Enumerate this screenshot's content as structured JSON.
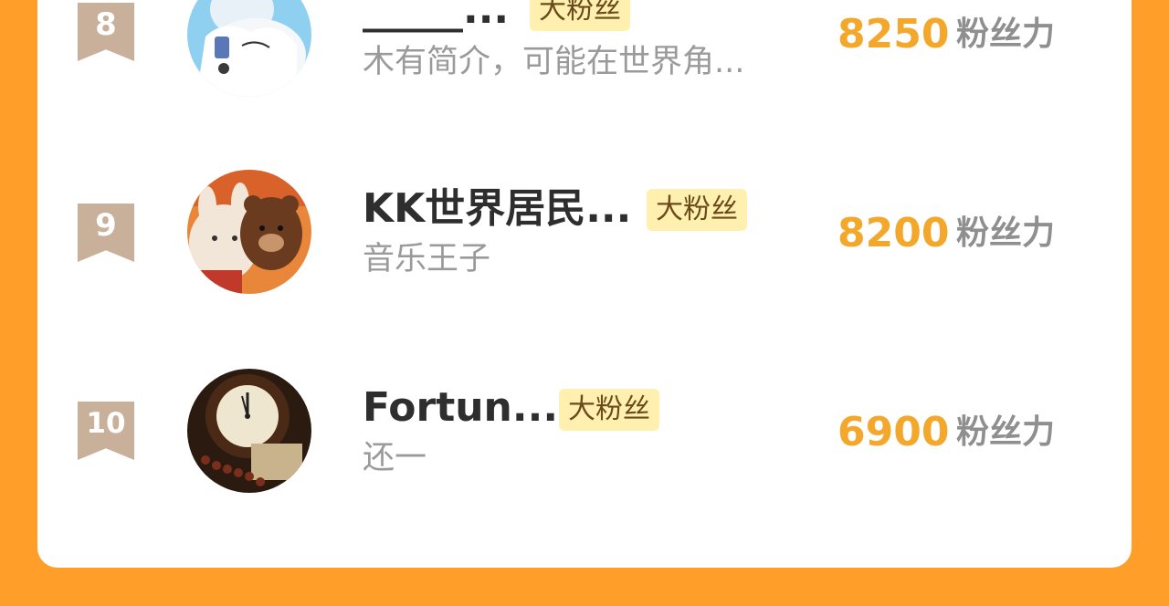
{
  "ranking": [
    {
      "rank": "8",
      "name": "_____...",
      "badge": "大粉丝",
      "bio": "木有简介，可能在世界角...",
      "score": "8250",
      "score_label": "粉丝力"
    },
    {
      "rank": "9",
      "name": "KK世界居民...",
      "badge": "大粉丝",
      "bio": "音乐王子",
      "score": "8200",
      "score_label": "粉丝力"
    },
    {
      "rank": "10",
      "name": "Fortun...",
      "badge": "大粉丝",
      "bio": "还一",
      "score": "6900",
      "score_label": "粉丝力"
    }
  ],
  "colors": {
    "background": "#FF9F2A",
    "card": "#FFFFFF",
    "score": "#F3A72B",
    "rank_ribbon": "#C8B09A",
    "badge_bg": "#FFF0B0"
  }
}
